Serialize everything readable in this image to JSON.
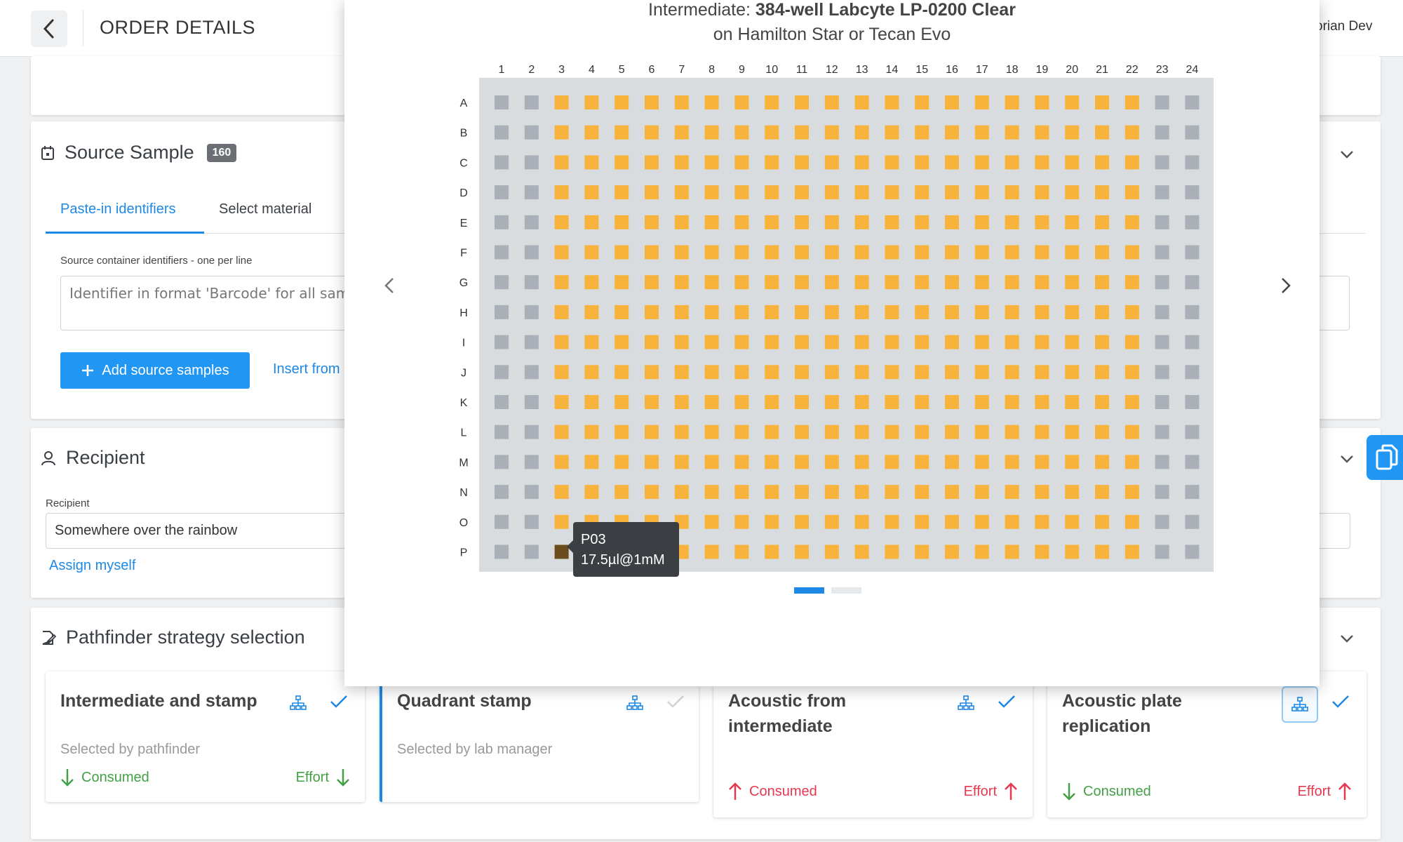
{
  "header": {
    "title": "ORDER DETAILS",
    "user": "orian Dev"
  },
  "source_sample": {
    "title": "Source Sample",
    "count": "160",
    "tabs": [
      "Paste-in identifiers",
      "Select material"
    ],
    "field_label": "Source container identifiers - one per line",
    "placeholder": "Identifier in format 'Barcode' for all sampl",
    "add_button": "Add source samples",
    "insert_link": "Insert from"
  },
  "recipient": {
    "title": "Recipient",
    "field_label": "Recipient",
    "value": "Somewhere over the rainbow",
    "assign_link": "Assign myself"
  },
  "pathfinder": {
    "title": "Pathfinder strategy selection",
    "strategies": [
      {
        "title": "Intermediate and stamp",
        "subtitle": "Selected by pathfinder",
        "consumed": "Consumed",
        "effort": "Effort",
        "trend": "down",
        "checked": true
      },
      {
        "title": "Quadrant stamp",
        "subtitle": "Selected by lab manager",
        "consumed": "",
        "effort": "",
        "trend": "none",
        "checked": false
      },
      {
        "title": "Acoustic from intermediate",
        "subtitle": "",
        "consumed": "Consumed",
        "effort": "Effort",
        "trend": "up",
        "checked": true
      },
      {
        "title": "Acoustic plate replication",
        "subtitle": "",
        "consumed": "Consumed",
        "effort": "Effort",
        "trend": "mixed",
        "checked": true
      }
    ]
  },
  "modal": {
    "title_prefix": "Intermediate: ",
    "title_bold": "384-well Labcyte LP-0200 Clear",
    "subtitle": "on Hamilton Star or Tecan Evo",
    "columns": [
      "1",
      "2",
      "3",
      "4",
      "5",
      "6",
      "7",
      "8",
      "9",
      "10",
      "11",
      "12",
      "13",
      "14",
      "15",
      "16",
      "17",
      "18",
      "19",
      "20",
      "21",
      "22",
      "23",
      "24"
    ],
    "rows": [
      "A",
      "B",
      "C",
      "D",
      "E",
      "F",
      "G",
      "H",
      "I",
      "J",
      "K",
      "L",
      "M",
      "N",
      "O",
      "P"
    ],
    "empty_columns": [
      "1",
      "2",
      "23",
      "24"
    ],
    "selected_well": "P03",
    "tooltip_line1": "P03",
    "tooltip_line2": "17.5µl@1mM",
    "carousel_pages": 2,
    "carousel_active": 1
  },
  "colors": {
    "accent": "#1e88e5",
    "well_filled": "#f7b33b",
    "well_empty": "#a9b0b7",
    "well_selected": "#6b4a1c",
    "plate_bg": "#d9dcde",
    "positive": "#43a047",
    "negative": "#e53950"
  },
  "icons": [
    "back-icon",
    "calendar-icon",
    "person-icon",
    "edit-icon",
    "chevron-down-icon",
    "plus-icon",
    "network-icon",
    "check-icon",
    "arrow-down-icon",
    "arrow-up-icon",
    "chevron-left-icon",
    "chevron-right-icon",
    "copy-icon"
  ]
}
